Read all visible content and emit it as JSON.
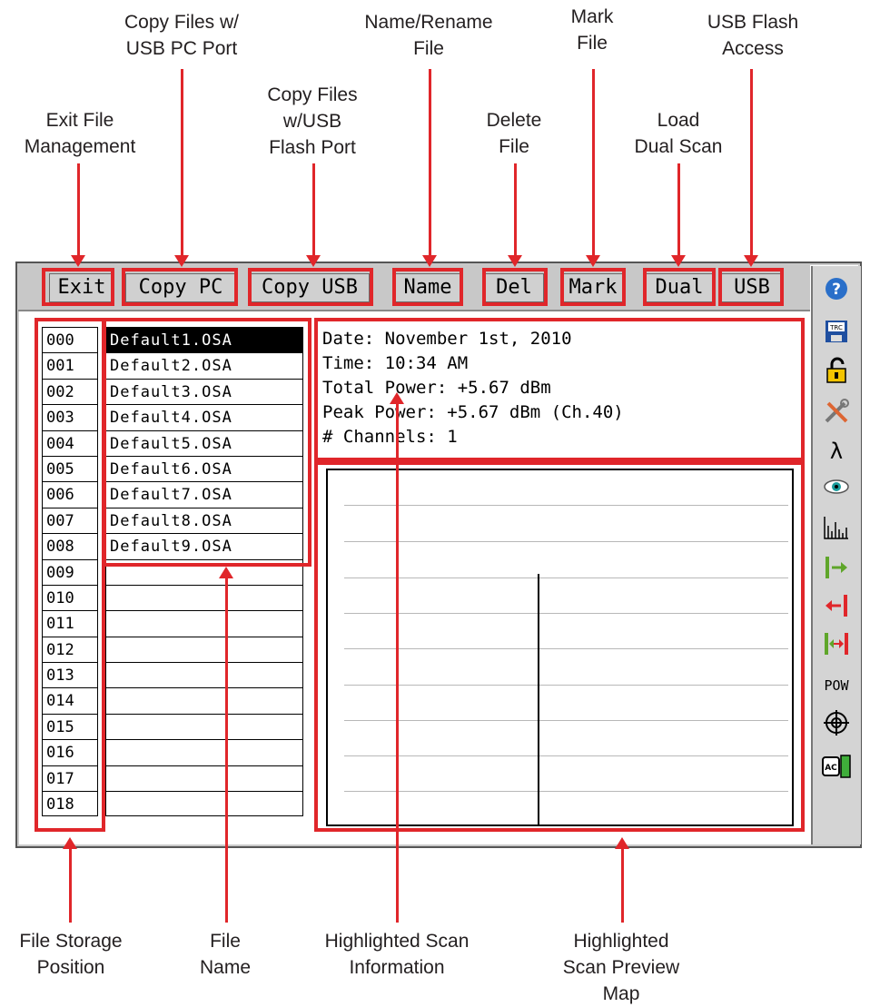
{
  "callouts": {
    "exit_file_management": [
      "Exit File",
      "Management"
    ],
    "copy_files_pc": [
      "Copy Files w/",
      "USB PC Port"
    ],
    "copy_files_flash": [
      "Copy Files",
      "w/USB",
      "Flash Port"
    ],
    "name_rename_file": [
      "Name/Rename",
      "File"
    ],
    "delete_file": [
      "Delete",
      "File"
    ],
    "mark_file": [
      "Mark",
      "File"
    ],
    "load_dual_scan": [
      "Load",
      "Dual Scan"
    ],
    "usb_flash_access": [
      "USB Flash",
      "Access"
    ],
    "file_storage_position": [
      "File Storage",
      "Position"
    ],
    "file_name": [
      "File",
      "Name"
    ],
    "highlighted_scan_information": [
      "Highlighted Scan",
      "Information"
    ],
    "highlighted_scan_preview_map": [
      "Highlighted",
      "Scan Preview",
      "Map"
    ]
  },
  "toolbar": {
    "exit_label": "Exit",
    "copy_pc_label": "Copy PC",
    "copy_usb_label": "Copy USB",
    "name_label": "Name",
    "del_label": "Del",
    "mark_label": "Mark",
    "dual_label": "Dual",
    "usb_label": "USB"
  },
  "sidebar": {
    "icons": [
      "help-icon",
      "trace-save-icon",
      "unlock-icon",
      "tools-icon",
      "wavelength-icon",
      "view-icon",
      "spectrum-icon",
      "marker-right-icon",
      "marker-left-icon",
      "marker-span-icon",
      "power-icon",
      "target-icon",
      "battery-ac-icon"
    ],
    "pow_label": "POW"
  },
  "file_list": {
    "positions": [
      "000",
      "001",
      "002",
      "003",
      "004",
      "005",
      "006",
      "007",
      "008",
      "009",
      "010",
      "011",
      "012",
      "013",
      "014",
      "015",
      "016",
      "017",
      "018"
    ],
    "names": [
      "Default1.OSA",
      "Default2.OSA",
      "Default3.OSA",
      "Default4.OSA",
      "Default5.OSA",
      "Default6.OSA",
      "Default7.OSA",
      "Default8.OSA",
      "Default9.OSA",
      "",
      "",
      "",
      "",
      "",
      "",
      "",
      "",
      "",
      ""
    ],
    "selected_index": 0
  },
  "scan_info": {
    "date": "Date: November 1st, 2010",
    "time": "Time: 10:34 AM",
    "total_power": "Total Power: +5.67 dBm",
    "peak_power": "Peak Power: +5.67 dBm (Ch.40)",
    "channels": "# Channels: 1"
  },
  "colors": {
    "annotation_red": "#e0262a",
    "selected_bg": "#000000",
    "toolbar_bg": "#c8c8c8"
  }
}
